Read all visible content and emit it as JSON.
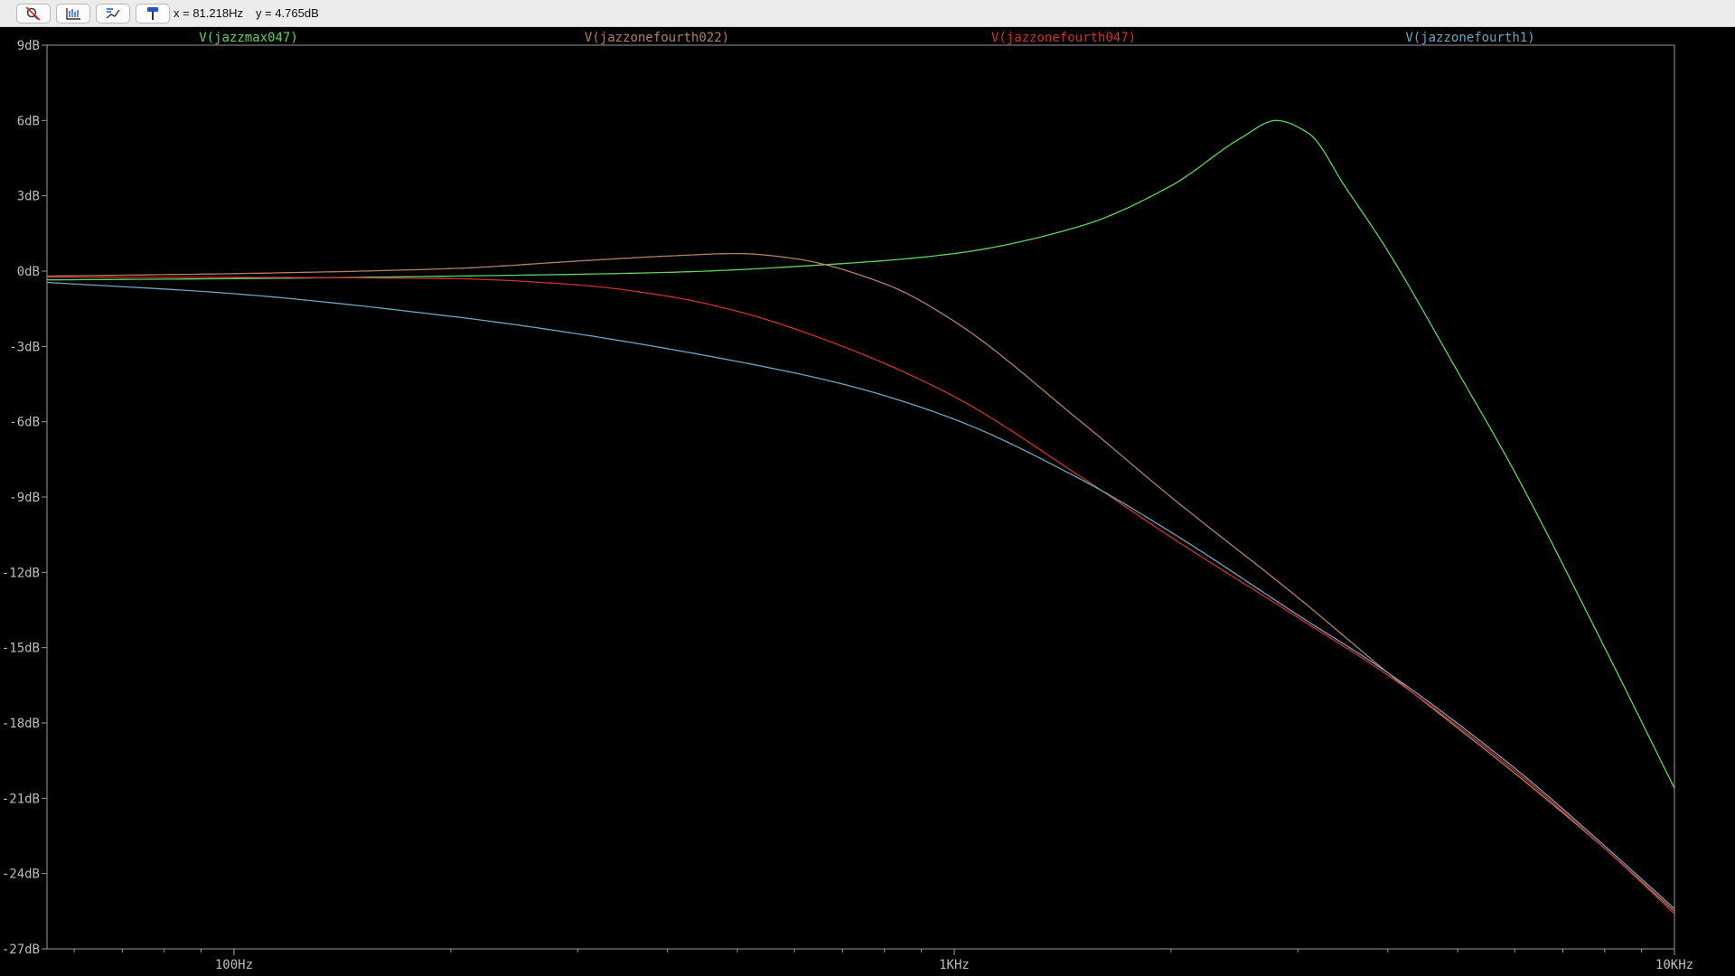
{
  "toolbar": {
    "buttons": [
      {
        "icon": "zoom-cancel-icon"
      },
      {
        "icon": "autorange-icon"
      },
      {
        "icon": "mark-data-icon"
      },
      {
        "icon": "probe-icon"
      }
    ],
    "readout_x": "x = 81.218Hz",
    "readout_y": "y = 4.765dB"
  },
  "chart_data": {
    "type": "line",
    "xscale": "log",
    "xlim": [
      55,
      10000
    ],
    "ylim": [
      -27,
      9
    ],
    "grid": false,
    "legend": "top",
    "yticks": [
      "9dB",
      "6dB",
      "3dB",
      "0dB",
      "-3dB",
      "-6dB",
      "-9dB",
      "-12dB",
      "-15dB",
      "-18dB",
      "-21dB",
      "-24dB",
      "-27dB"
    ],
    "ytick_values": [
      9,
      6,
      3,
      0,
      -3,
      -6,
      -9,
      -12,
      -15,
      -18,
      -21,
      -24,
      -27
    ],
    "xticks": [
      {
        "value": 100,
        "label": "100Hz"
      },
      {
        "value": 1000,
        "label": "1KHz"
      },
      {
        "value": 10000,
        "label": "10KHz"
      }
    ],
    "axis_color": "#9a9a9a",
    "series": [
      {
        "name": "V(jazzmax047)",
        "color": "#5fd35f",
        "x": [
          55,
          100,
          200,
          400,
          700,
          1000,
          1500,
          2000,
          2500,
          2800,
          3100,
          3500,
          4000,
          5000,
          6000,
          8000,
          10000
        ],
        "y": [
          -0.35,
          -0.3,
          -0.2,
          -0.05,
          0.3,
          0.7,
          1.8,
          3.4,
          5.3,
          6.0,
          5.5,
          3.3,
          0.8,
          -4.0,
          -8.0,
          -15.0,
          -20.6
        ]
      },
      {
        "name": "V(jazzonefourth022)",
        "color": "#b08060",
        "x": [
          55,
          100,
          200,
          300,
          400,
          500,
          600,
          800,
          1000,
          1500,
          2000,
          3000,
          4000,
          6000,
          8000,
          10000
        ],
        "y": [
          -0.2,
          -0.1,
          0.1,
          0.4,
          0.6,
          0.7,
          0.5,
          -0.5,
          -2.0,
          -6.0,
          -9.0,
          -13.0,
          -16.0,
          -20.0,
          -23.0,
          -25.5
        ]
      },
      {
        "name": "V(jazzonefourth047)",
        "color": "#d03030",
        "x": [
          55,
          100,
          200,
          300,
          400,
          500,
          700,
          1000,
          1500,
          2000,
          3000,
          4000,
          6000,
          8000,
          10000
        ],
        "y": [
          -0.25,
          -0.25,
          -0.3,
          -0.55,
          -1.0,
          -1.6,
          -3.0,
          -5.0,
          -8.2,
          -10.6,
          -13.8,
          -16.1,
          -19.9,
          -23.0,
          -25.6
        ]
      },
      {
        "name": "V(jazzonefourth1)",
        "color": "#6aa6c0",
        "x": [
          55,
          100,
          200,
          300,
          500,
          700,
          1000,
          1500,
          2000,
          3000,
          4000,
          6000,
          8000,
          10000
        ],
        "y": [
          -0.45,
          -0.9,
          -1.8,
          -2.5,
          -3.6,
          -4.5,
          -5.9,
          -8.3,
          -10.4,
          -13.7,
          -16.0,
          -19.8,
          -22.9,
          -25.4
        ]
      }
    ]
  }
}
